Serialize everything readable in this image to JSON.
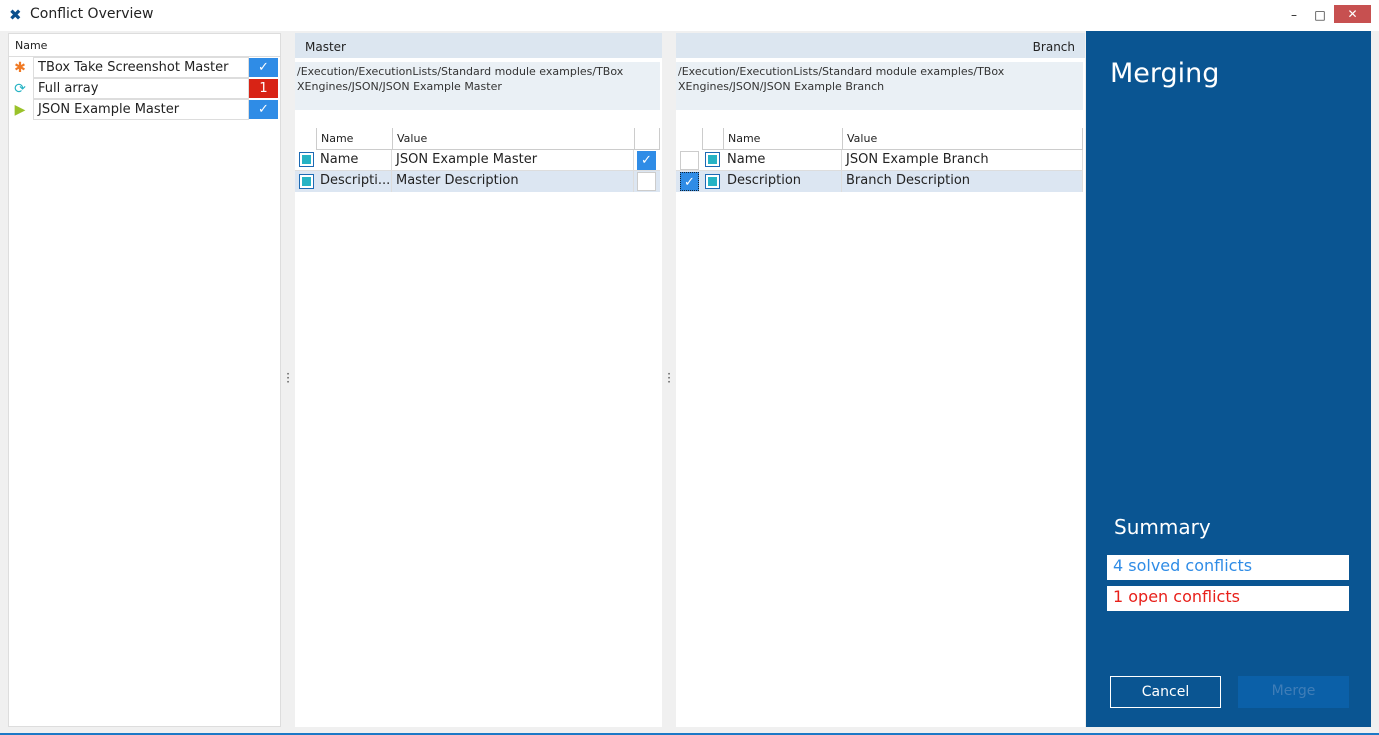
{
  "window": {
    "title": "Conflict Overview",
    "minimize": "–",
    "maximize": "□",
    "close": "✕"
  },
  "left": {
    "header": "Name",
    "items": [
      {
        "icon": "module-icon",
        "name": "TBox Take Screenshot Master",
        "status": "✓",
        "color": "#2f8ce6"
      },
      {
        "icon": "loop-icon",
        "name": "Full array",
        "status": "1",
        "color": "#d82315"
      },
      {
        "icon": "play-icon",
        "name": "JSON Example Master",
        "status": "✓",
        "color": "#2f8ce6"
      }
    ]
  },
  "master": {
    "header": "Master",
    "path": "/Execution/ExecutionLists/Standard module examples/TBox XEngines/JSON/JSON Example Master",
    "columns": [
      "Name",
      "Value"
    ],
    "rows": [
      {
        "name": "Name",
        "value": "JSON Example Master",
        "checked": true
      },
      {
        "name": "Descripti...",
        "value": "Master Description",
        "checked": false
      }
    ]
  },
  "branch": {
    "header": "Branch",
    "path": "/Execution/ExecutionLists/Standard module examples/TBox XEngines/JSON/JSON Example Branch",
    "columns": [
      "Name",
      "Value"
    ],
    "rows": [
      {
        "name": "Name",
        "value": "JSON Example Branch",
        "checked": false
      },
      {
        "name": "Description",
        "value": "Branch Description",
        "checked": true
      }
    ]
  },
  "merging": {
    "title": "Merging",
    "summary_title": "Summary",
    "solved": "4 solved conflicts",
    "open": "1 open conflicts",
    "cancel": "Cancel",
    "merge": "Merge",
    "solved_color": "#2f8ce6",
    "open_color": "#e8201a"
  }
}
